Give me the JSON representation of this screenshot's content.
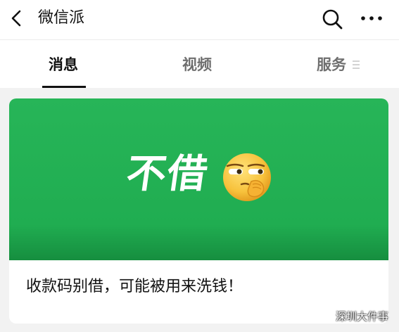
{
  "header": {
    "title": "微信派",
    "icons": [
      "back-icon",
      "search-icon",
      "more-icon"
    ]
  },
  "tabs": [
    {
      "label": "消息",
      "active": true
    },
    {
      "label": "视频",
      "active": false
    },
    {
      "label": "服务",
      "active": false
    }
  ],
  "card": {
    "banner_text": "不借",
    "banner_color": "#22b052",
    "caption": "收款码别借，可能被用来洗钱！"
  },
  "watermark": {
    "text": "深圳大件事"
  }
}
